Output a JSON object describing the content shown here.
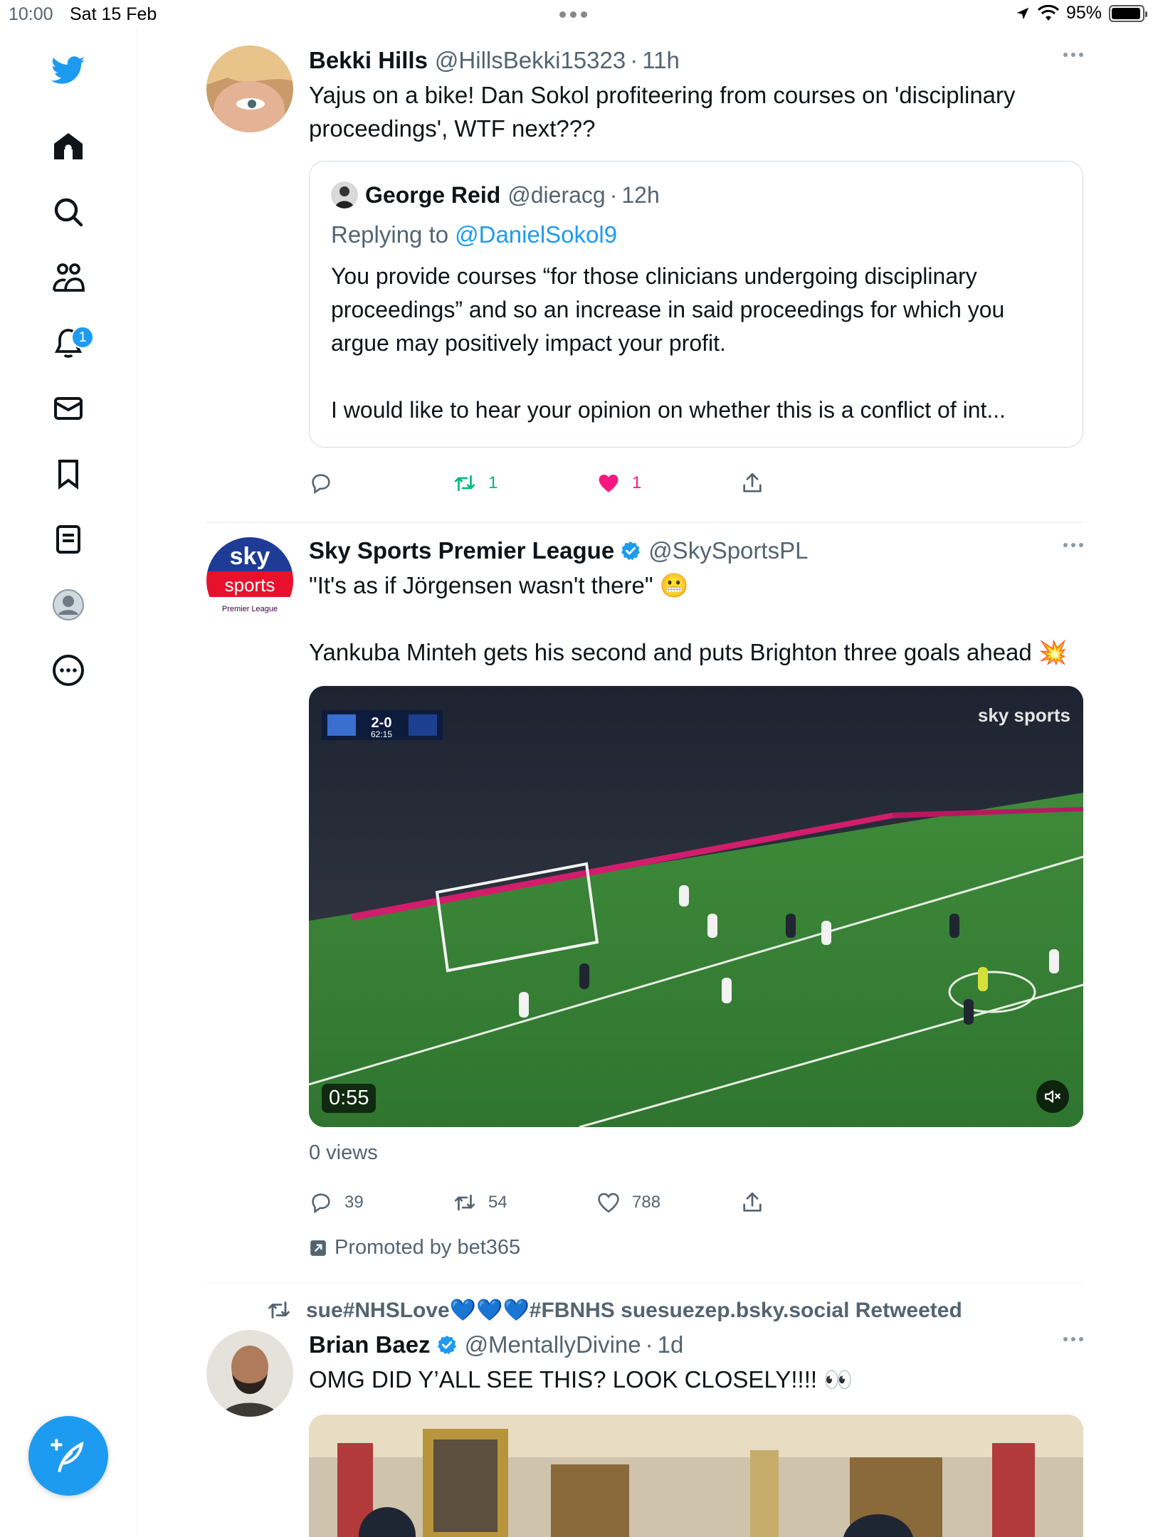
{
  "status_bar": {
    "time": "10:00",
    "date": "Sat 15 Feb",
    "battery": "95%",
    "battery_level": 0.95
  },
  "sidebar": {
    "items": [
      {
        "icon": "twitter-logo-icon"
      },
      {
        "icon": "home-icon"
      },
      {
        "icon": "search-icon"
      },
      {
        "icon": "communities-icon"
      },
      {
        "icon": "notifications-icon",
        "badge": "1"
      },
      {
        "icon": "messages-icon"
      },
      {
        "icon": "bookmarks-icon"
      },
      {
        "icon": "lists-icon"
      },
      {
        "icon": "profile-icon"
      },
      {
        "icon": "more-icon"
      }
    ],
    "compose_icon": "compose-tweet-icon"
  },
  "feed": {
    "tweet1": {
      "name": "Bekki Hills",
      "handle": "@HillsBekki15323",
      "dot": "·",
      "time": "11h",
      "text": "Yajus on a bike! Dan Sokol profiteering from courses on 'disciplinary proceedings', WTF next???",
      "quote": {
        "name": "George Reid",
        "handle": "@dieracg",
        "dot": "·",
        "time": "12h",
        "replying_label": "Replying to",
        "replying_to": "@DanielSokol9",
        "text": "You provide courses “for those clinicians undergoing disciplinary proceedings” and so an increase in said proceedings for which you argue may positively impact your profit.\n\nI would like to hear your opinion on whether this is a conflict of int..."
      },
      "actions": {
        "reply": "",
        "retweets": "1",
        "likes": "1"
      }
    },
    "tweet2": {
      "name": "Sky Sports Premier League",
      "handle": "@SkySportsPL",
      "text": "\"It's as if Jörgensen wasn't there\" 😬\n\nYankuba Minteh gets his second and puts Brighton three goals ahead 💥",
      "video": {
        "duration": "0:55",
        "scoreboard": "2-0",
        "clock": "62:15",
        "watermark": "sky sports"
      },
      "views": "0 views",
      "actions": {
        "reply": "39",
        "retweets": "54",
        "likes": "788"
      },
      "promoted": "Promoted by bet365",
      "avatar_logo": {
        "top": "sky",
        "mid": "sports",
        "bottom": "Premier League"
      }
    },
    "tweet3": {
      "retweeted_by": "sue#NHSLove💙💙💙#FBNHS suesuezep.bsky.social Retweeted",
      "name": "Brian Baez",
      "handle": "@MentallyDivine",
      "dot": "·",
      "time": "1d",
      "text": "OMG DID Y’ALL SEE THIS? LOOK CLOSELY!!!! 👀"
    }
  },
  "colors": {
    "accent": "#1d9bf0",
    "retweet": "#00ba7c",
    "like": "#f91880",
    "muted": "#536471"
  }
}
